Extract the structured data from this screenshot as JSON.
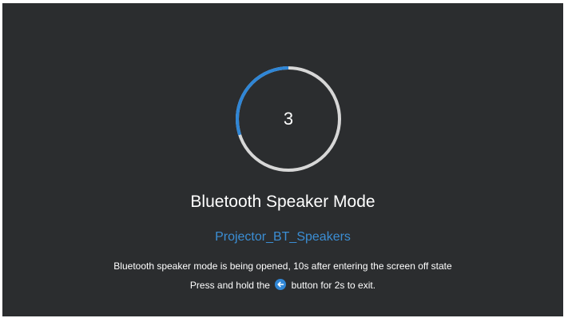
{
  "countdown": {
    "value": "3",
    "progress_fraction": 0.3
  },
  "title": "Bluetooth Speaker Mode",
  "device_name": "Projector_BT_Speakers",
  "description": "Bluetooth speaker mode is being opened, 10s after entering the screen off state",
  "exit_hint": {
    "before_icon": "Press and hold the",
    "icon": "back-arrow-icon",
    "after_icon": "button for 2s to exit."
  },
  "colors": {
    "background": "#2b2d2f",
    "accent": "#2f86d6",
    "ring_track": "#d7d7d7",
    "text": "#ffffff",
    "device_name": "#3b8ed4"
  }
}
